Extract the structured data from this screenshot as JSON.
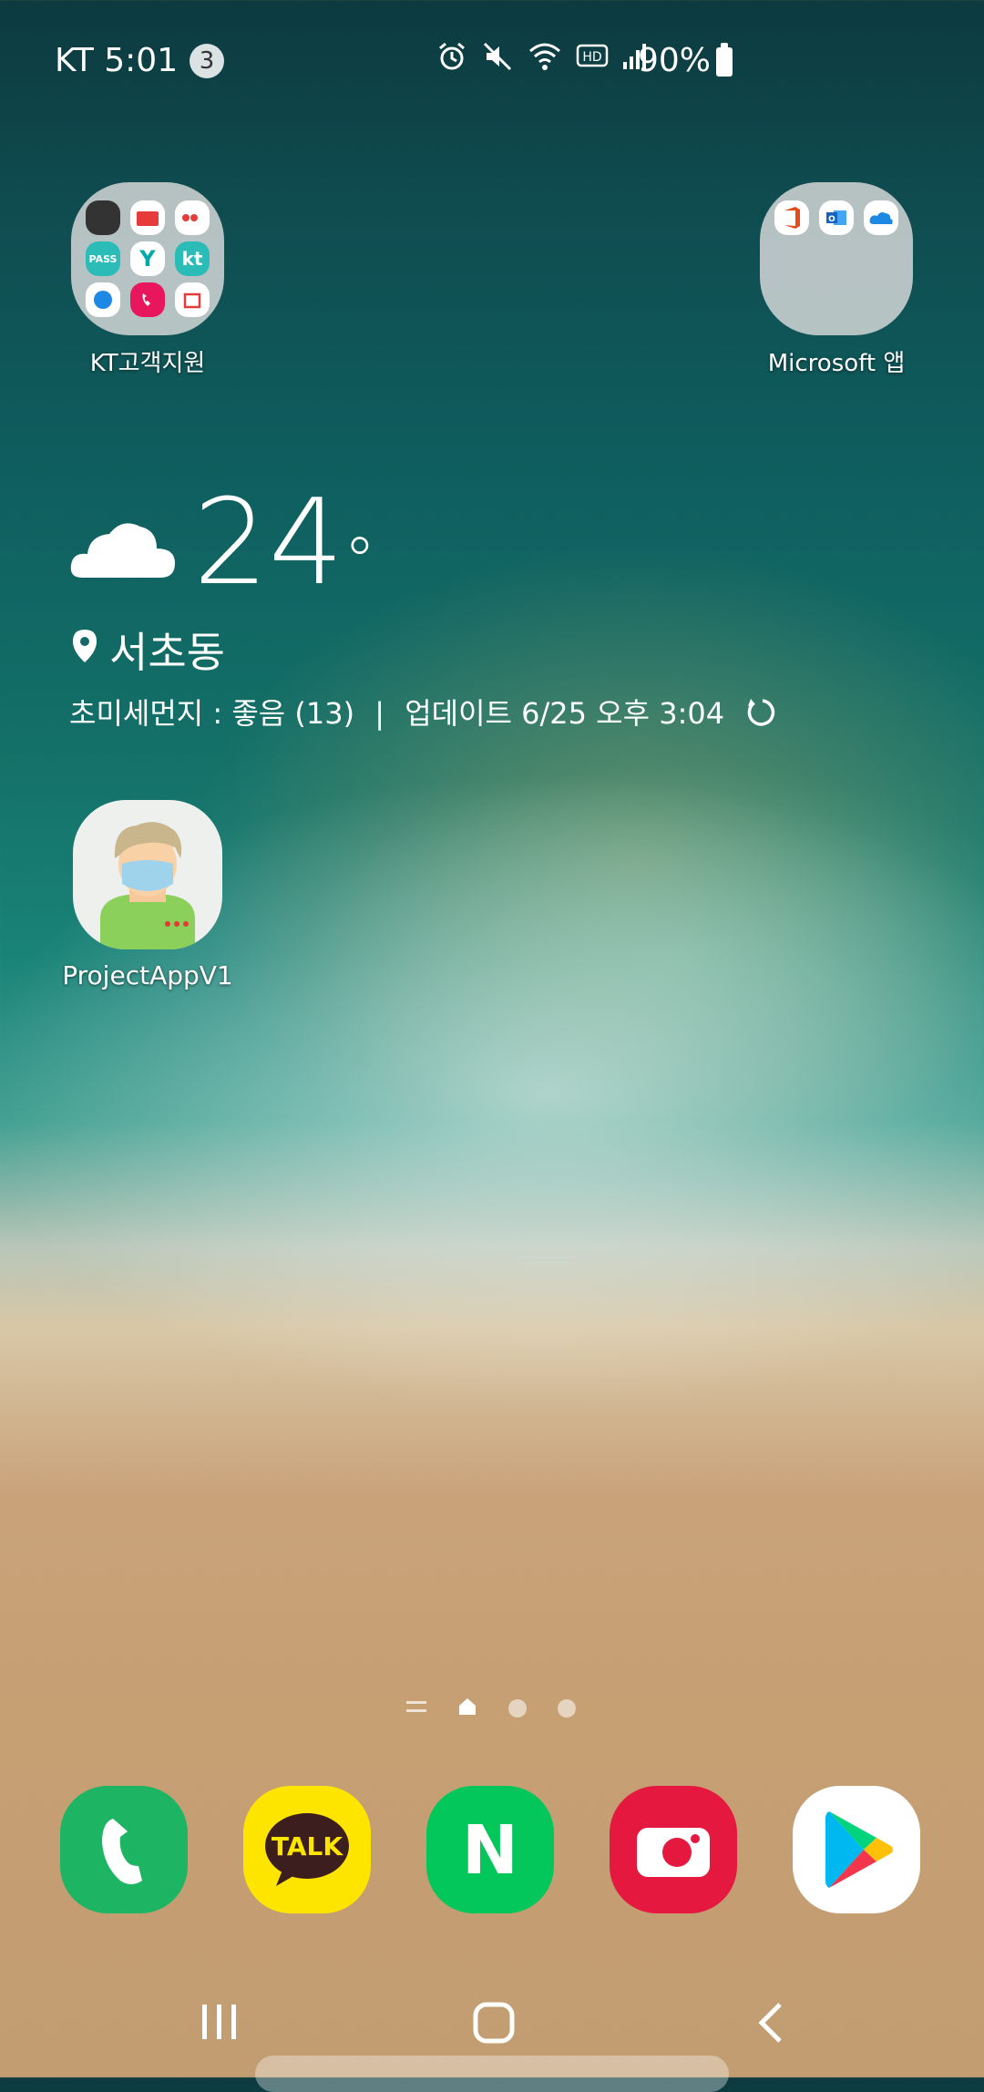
{
  "status_bar": {
    "carrier": "KT",
    "time": "5:01",
    "notification_count": "3",
    "battery_percent": "90%",
    "icons": [
      "alarm-icon",
      "mute-icon",
      "wifi-icon",
      "hd-icon",
      "signal-icon",
      "battery-icon"
    ]
  },
  "folders": [
    {
      "label": "KT고객지원"
    },
    {
      "label": "Microsoft 앱"
    }
  ],
  "weather": {
    "temperature": "24",
    "degree": "°",
    "location": "서초동",
    "dust_text": "초미세먼지 : 좋음 (13)",
    "update_text": "업데이트 6/25 오후 3:04",
    "condition_icon": "cloud-icon"
  },
  "apps": [
    {
      "label": "ProjectAppV1"
    }
  ],
  "page_indicator": {
    "pages": 3,
    "current": 1
  },
  "dock": [
    "phone-icon",
    "kakaotalk-icon",
    "naver-icon",
    "camera-icon",
    "play-store-icon"
  ],
  "dock_text": {
    "kakaotalk": "TALK",
    "naver": "N",
    "kt": "kt",
    "pass": "PASS"
  },
  "colors": {
    "phone": "#1db564",
    "kakaotalk": "#fee500",
    "naver": "#03c75a",
    "camera": "#e5183f",
    "play": "#ffffff"
  }
}
